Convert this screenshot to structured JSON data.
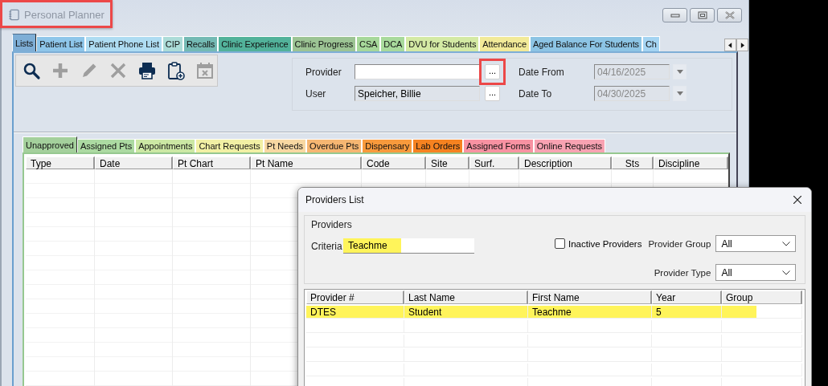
{
  "window": {
    "title": "Personal Planner",
    "title_highlighted": true
  },
  "tabs": [
    {
      "label": "Lists",
      "selected": true,
      "color": "#7eaed6"
    },
    {
      "label": "Patient List",
      "selected": false,
      "color": "#8ec6ea"
    },
    {
      "label": "Patient Phone List",
      "selected": false,
      "color": "#aedcf2"
    },
    {
      "label": "CIP",
      "selected": false,
      "color": "#acdcd8"
    },
    {
      "label": "Recalls",
      "selected": false,
      "color": "#74bab4"
    },
    {
      "label": "Clinic Experience",
      "selected": false,
      "color": "#52b29a"
    },
    {
      "label": "Clinic Progress",
      "selected": false,
      "color": "#9cc494"
    },
    {
      "label": "CSA",
      "selected": false,
      "color": "#a6d89a"
    },
    {
      "label": "DCA",
      "selected": false,
      "color": "#a8da9c"
    },
    {
      "label": "DVU for Students",
      "selected": false,
      "color": "#d4eaa4"
    },
    {
      "label": "Attendance",
      "selected": false,
      "color": "#f2ea98"
    },
    {
      "label": "Aged Balance For Students",
      "selected": false,
      "color": "#8cc4e4"
    },
    {
      "label": "Ch",
      "selected": false,
      "color": "#a4d4f2"
    }
  ],
  "toolbar": [
    {
      "kind": "search",
      "disabled": false
    },
    {
      "kind": "add",
      "disabled": true
    },
    {
      "kind": "edit",
      "disabled": true
    },
    {
      "kind": "delete",
      "disabled": true
    },
    {
      "kind": "print",
      "disabled": false
    },
    {
      "kind": "clipboard",
      "disabled": false
    },
    {
      "kind": "calendar",
      "disabled": true
    }
  ],
  "filters": {
    "provider": {
      "label": "Provider",
      "button": "...",
      "button_highlighted": true
    },
    "user": {
      "label": "User",
      "value": "Speicher, Billie",
      "button": "..."
    },
    "date_from": {
      "label": "Date From",
      "value": "04/16/2025",
      "disabled": true
    },
    "date_to": {
      "label": "Date To",
      "value": "04/30/2025",
      "disabled": true
    }
  },
  "subtabs": [
    {
      "label": "Unapproved",
      "selected": true,
      "color": "#a4d09c"
    },
    {
      "label": "Assigned Pts",
      "selected": false,
      "color": "#acdaa2"
    },
    {
      "label": "Appointments",
      "selected": false,
      "color": "#cce8a4"
    },
    {
      "label": "Chart Requests",
      "selected": false,
      "color": "#f2f0a4"
    },
    {
      "label": "Pt Needs",
      "selected": false,
      "color": "#f8d8a2"
    },
    {
      "label": "Overdue Pts",
      "selected": false,
      "color": "#f6b672"
    },
    {
      "label": "Dispensary",
      "selected": false,
      "color": "#f89a3c"
    },
    {
      "label": "Lab Orders",
      "selected": false,
      "color": "#f68220"
    },
    {
      "label": "Assigned Forms",
      "selected": false,
      "color": "#f892a2"
    },
    {
      "label": "Online Requests",
      "selected": false,
      "color": "#f8a2b2"
    }
  ],
  "grid": {
    "columns": [
      "Type",
      "Date",
      "Pt Chart",
      "Pt Name",
      "Code",
      "Site",
      "Surf.",
      "Description",
      "Sts",
      "Discipline"
    ]
  },
  "dialog": {
    "title": "Providers List",
    "group_title": "Providers",
    "criteria": {
      "label": "Criteria",
      "value": "Teachme",
      "highlighted": true
    },
    "inactive": {
      "label": "Inactive Providers",
      "checked": false
    },
    "provider_group": {
      "label": "Provider Group",
      "value": "All"
    },
    "provider_type": {
      "label": "Provider Type",
      "value": "All"
    },
    "list": {
      "columns": [
        "Provider #",
        "Last Name",
        "First Name",
        "Year",
        "Group"
      ],
      "rows": [
        {
          "cells": [
            "DTES",
            "Student",
            "Teachme",
            "5",
            ""
          ],
          "highlighted": true
        }
      ]
    }
  }
}
